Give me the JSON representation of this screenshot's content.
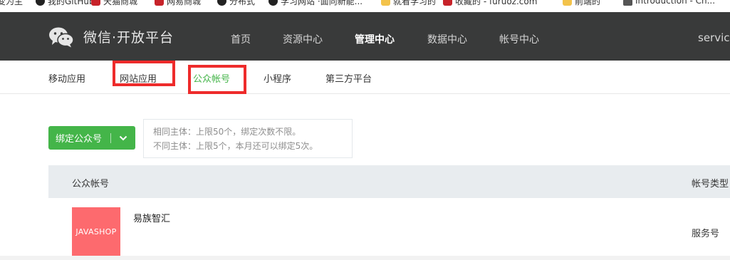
{
  "bookmarks": [
    {
      "icon": "folder-icon",
      "label": "变为主"
    },
    {
      "icon": "github-icon",
      "label": "我的GitHub"
    },
    {
      "icon": "red-square-icon",
      "label": "天猫商城"
    },
    {
      "icon": "red-square-icon",
      "label": "网易商城"
    },
    {
      "icon": "github-icon",
      "label": "分布式"
    },
    {
      "icon": "github-icon",
      "label": "学习网站 ·面向新能..."
    },
    {
      "icon": "folder-icon",
      "label": "就看学习的"
    },
    {
      "icon": "red-square-icon",
      "label": "收藏的 - furuoz.com"
    },
    {
      "icon": "folder-icon",
      "label": "前端的"
    },
    {
      "icon": "hat-icon",
      "label": "Introduction - Ch..."
    }
  ],
  "header": {
    "brand": "微信·开放平台",
    "nav": [
      "首页",
      "资源中心",
      "管理中心",
      "数据中心",
      "帐号中心"
    ],
    "active_nav": "管理中心",
    "user": "service"
  },
  "subnav": {
    "items": [
      "移动应用",
      "网站应用",
      "公众帐号",
      "小程序",
      "第三方平台"
    ],
    "active": "公众帐号"
  },
  "main": {
    "bind_button": "绑定公众号",
    "tip_lines": [
      "相同主体：上限50个，绑定次数不限。",
      "不同主体：上限5个，本月还可以绑定5次。"
    ],
    "table_headers": [
      "公众帐号",
      "帐号类型"
    ],
    "rows": [
      {
        "avatar_text": "JAVASHOP",
        "name": "易族智汇",
        "type": "服务号"
      }
    ]
  },
  "colors": {
    "topbar": "#393a3a",
    "accent_green": "#44b549",
    "highlight_red": "#ee2b2b",
    "avatar_bg": "#fd6a6e"
  }
}
